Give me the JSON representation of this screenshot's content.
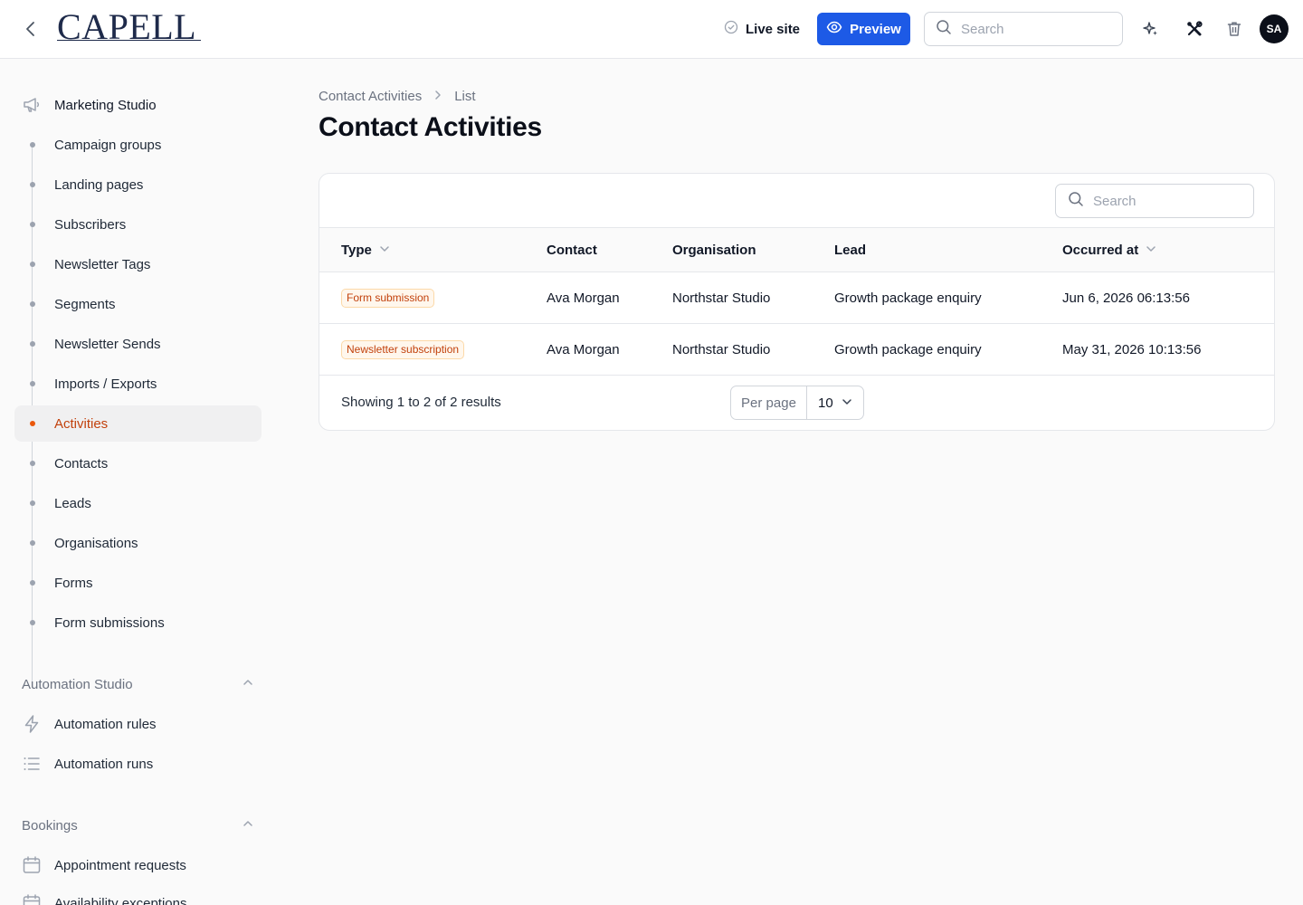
{
  "header": {
    "logo": "CAPELL",
    "live_site": "Live site",
    "preview": "Preview",
    "search_placeholder": "Search",
    "avatar_initials": "SA",
    "accent_color": "#1d5ae6"
  },
  "sidebar": {
    "group_title": "Marketing Studio",
    "items": [
      {
        "label": "Campaign groups"
      },
      {
        "label": "Landing pages"
      },
      {
        "label": "Subscribers"
      },
      {
        "label": "Newsletter Tags"
      },
      {
        "label": "Segments"
      },
      {
        "label": "Newsletter Sends"
      },
      {
        "label": "Imports / Exports"
      },
      {
        "label": "Activities",
        "active": true
      },
      {
        "label": "Contacts"
      },
      {
        "label": "Leads"
      },
      {
        "label": "Organisations"
      },
      {
        "label": "Forms"
      },
      {
        "label": "Form submissions"
      }
    ],
    "automation": {
      "title": "Automation Studio",
      "items": [
        {
          "label": "Automation rules",
          "icon": "lightning-icon"
        },
        {
          "label": "Automation runs",
          "icon": "list-icon"
        }
      ]
    },
    "bookings": {
      "title": "Bookings",
      "items": [
        {
          "label": "Appointment requests",
          "icon": "calendar-icon"
        },
        {
          "label": "Availability exceptions",
          "icon": "calendar-icon"
        }
      ]
    }
  },
  "breadcrumb": {
    "parent": "Contact Activities",
    "current": "List"
  },
  "page": {
    "title": "Contact Activities"
  },
  "table": {
    "search_placeholder": "Search",
    "columns": {
      "type": "Type",
      "contact": "Contact",
      "organisation": "Organisation",
      "lead": "Lead",
      "occurred_at": "Occurred at"
    },
    "rows": [
      {
        "type": "Form submission",
        "contact": "Ava Morgan",
        "organisation": "Northstar Studio",
        "lead": "Growth package enquiry",
        "occurred_at": "Jun 6, 2026 06:13:56"
      },
      {
        "type": "Newsletter subscription",
        "contact": "Ava Morgan",
        "organisation": "Northstar Studio",
        "lead": "Growth package enquiry",
        "occurred_at": "May 31, 2026 10:13:56"
      }
    ],
    "footer": {
      "showing": "Showing 1 to 2 of 2 results",
      "per_page_label": "Per page",
      "per_page_value": "10"
    }
  }
}
